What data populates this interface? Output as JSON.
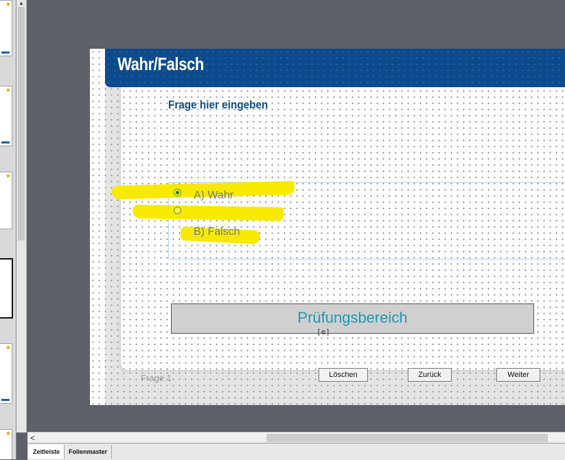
{
  "slide": {
    "title": "Wahr/Falsch",
    "question_placeholder": "Frage hier eingeben",
    "options": [
      {
        "label": "A) Wahr",
        "selected": true
      },
      {
        "label": "B) Falsch",
        "selected": false
      }
    ],
    "review_area_label": "Prüfungsbereich",
    "question_number": "Frage 1",
    "buttons": {
      "clear": "Löschen",
      "back": "Zurück",
      "next": "Weiter"
    }
  },
  "bottom_tabs": [
    {
      "label": "Zeitleiste",
      "active": true
    },
    {
      "label": "Folienmaster",
      "active": false
    }
  ],
  "icons": {
    "review_area_icon": "[e]",
    "scroll_left": "<"
  },
  "colors": {
    "title_bar": "#0b4a8c",
    "question_text": "#0d4d80",
    "review_label": "#2597b1",
    "highlight": "#f7ea00"
  }
}
